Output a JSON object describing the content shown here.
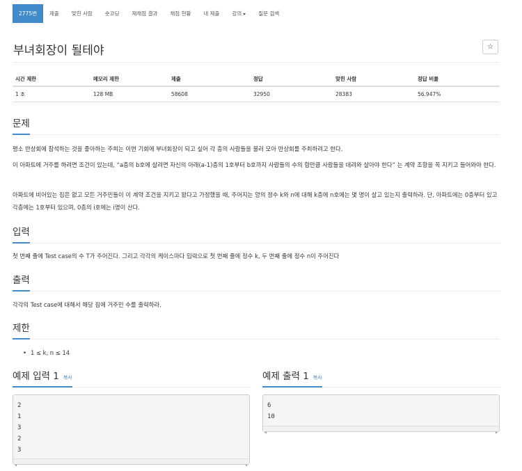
{
  "nav": {
    "items": [
      {
        "label": "2775번",
        "active": true
      },
      {
        "label": "제출"
      },
      {
        "label": "맞힌 사람"
      },
      {
        "label": "숏코딩"
      },
      {
        "label": "재채점 결과"
      },
      {
        "label": "채점 현황"
      },
      {
        "label": "내 제출"
      },
      {
        "label": "강의"
      },
      {
        "label": "질문 검색"
      }
    ]
  },
  "problem": {
    "title": "부녀회장이 될테야",
    "star_icon": "☆"
  },
  "stats": {
    "headers": [
      "시간 제한",
      "메모리 제한",
      "제출",
      "정답",
      "맞힌 사람",
      "정답 비율"
    ],
    "values": [
      "1 초",
      "128 MB",
      "58608",
      "32950",
      "28383",
      "56.947%"
    ]
  },
  "sections": {
    "description_title": "문제",
    "description": [
      "평소 반상회에 참석하는 것을 좋아하는 주희는 이번 기회에 부녀회장이 되고 싶어 각 층의 사람들을 불러 모아 반상회를 주최하려고 한다.",
      "이 아파트에 거주를 하려면 조건이 있는데, “a층의 b호에 살려면 자신의 아래(a-1)층의 1호부터 b호까지 사람들의 수의 합만큼 사람들을 데려와 살아야 한다” 는 계약 조항을 꼭 지키고 들어와야 한다.",
      "아파트에 비어있는 집은 없고 모든 거주민들이 이 계약 조건을 지키고 왔다고 가정했을 때, 주어지는 양의 정수 k와 n에 대해 k층에 n호에는 몇 명이 살고 있는지 출력하라. 단, 아파트에는 0층부터 있고 각층에는 1호부터 있으며, 0층의 i호에는 i명이 산다."
    ],
    "input_title": "입력",
    "input": "첫 번째 줄에 Test case의 수 T가 주어진다. 그리고 각각의 케이스마다 입력으로 첫 번째 줄에 정수 k, 두 번째 줄에 정수 n이 주어진다",
    "output_title": "출력",
    "output": "각각의 Test case에 대해서 해당 집에 거주민 수를 출력하라.",
    "limit_title": "제한",
    "limit_items": [
      "1 ≤ k, n ≤ 14"
    ]
  },
  "samples": {
    "input_title": "예제 입력 1",
    "output_title": "예제 출력 1",
    "copy_label": "복사",
    "input_lines": [
      "2",
      "1",
      "3",
      "2",
      "3"
    ],
    "output_lines": [
      "6",
      "10"
    ]
  }
}
